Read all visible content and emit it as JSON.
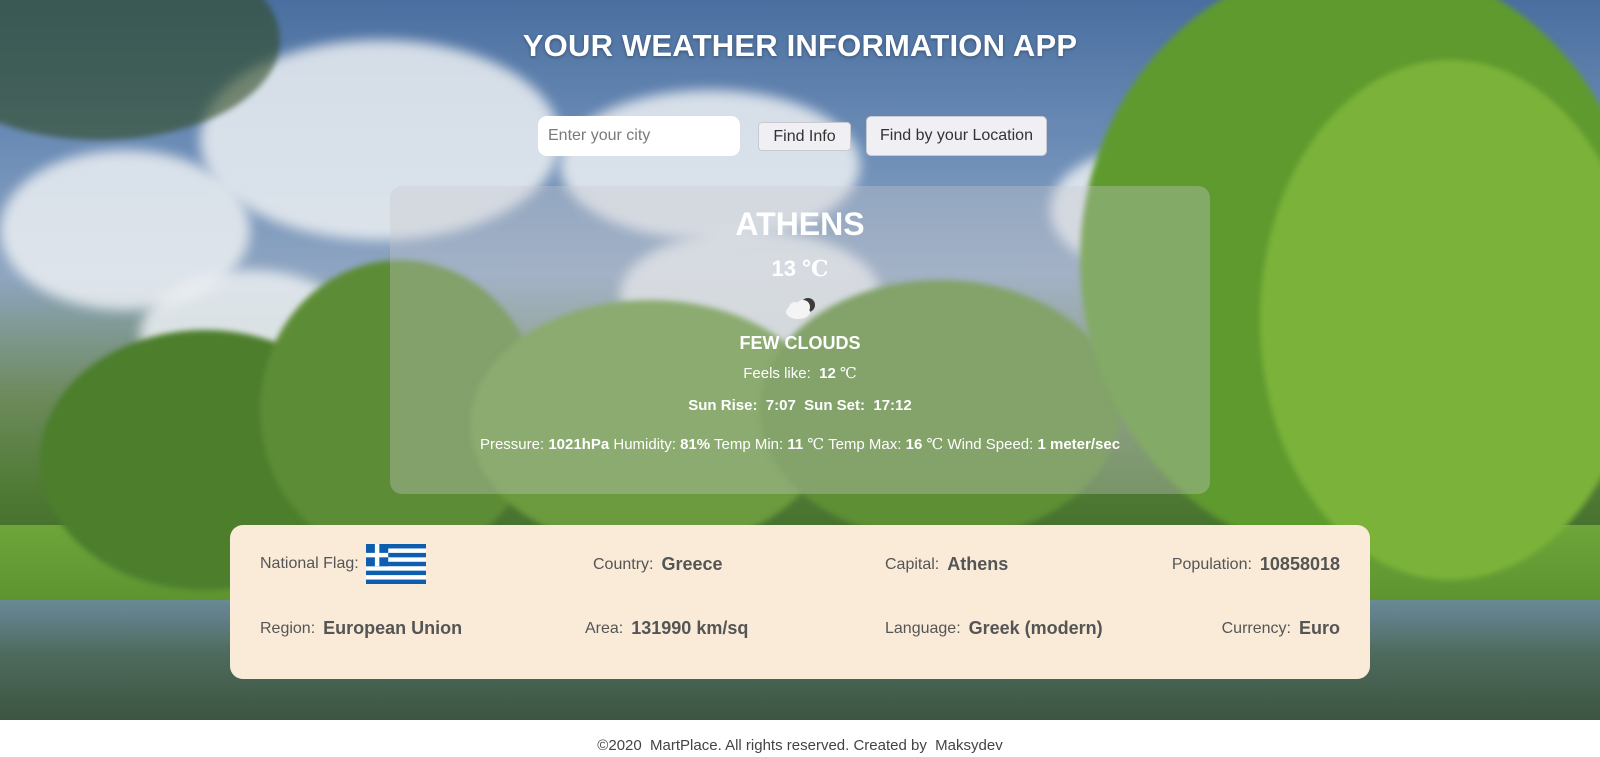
{
  "app": {
    "title": "YOUR WEATHER INFORMATION APP"
  },
  "search": {
    "placeholder": "Enter your city",
    "value": "",
    "find_label": "Find Info",
    "location_label": "Find by your Location"
  },
  "weather": {
    "city": "ATHENS",
    "temp": "13",
    "unit": "℃",
    "icon": "cloud-moon-icon",
    "description": "FEW CLOUDS",
    "feels_like_label": "Feels like:",
    "feels_like": "12",
    "sunrise_label": "Sun Rise:",
    "sunrise": "7:07",
    "sunset_label": "Sun Set:",
    "sunset": "17:12",
    "pressure_label": "Pressure:",
    "pressure": "1021hPa",
    "humidity_label": "Humidity:",
    "humidity": "81%",
    "temp_min_label": "Temp Min:",
    "temp_min": "11",
    "temp_max_label": "Temp Max:",
    "temp_max": "16",
    "wind_label": "Wind Speed:",
    "wind": "1 meter/sec"
  },
  "country": {
    "flag_label": "National Flag:",
    "flag_icon": "greece-flag-icon",
    "country_label": "Country:",
    "country": "Greece",
    "capital_label": "Capital:",
    "capital": "Athens",
    "population_label": "Population:",
    "population": "10858018",
    "region_label": "Region:",
    "region": "European Union",
    "area_label": "Area:",
    "area": "131990 km/sq",
    "language_label": "Language:",
    "language": "Greek (modern)",
    "currency_label": "Currency:",
    "currency": "Euro"
  },
  "footer": {
    "text": "©2020  MartPlace. All rights reserved. Created by  Maksydev"
  },
  "colors": {
    "card_bg": "#f9ebd8",
    "flag_blue": "#0d5eaf",
    "text_white": "#ffffff"
  }
}
